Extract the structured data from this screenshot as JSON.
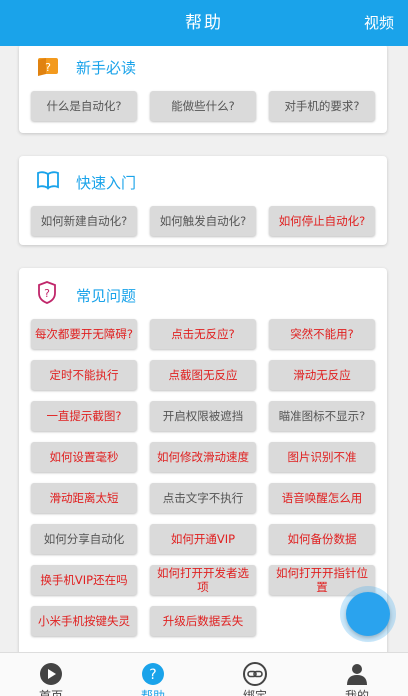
{
  "header": {
    "title": "帮助",
    "right_label": "视频"
  },
  "sections": [
    {
      "title": "新手必读",
      "icon": "book-icon",
      "buttons": [
        {
          "label": "什么是自动化?",
          "highlight": false
        },
        {
          "label": "能做些什么?",
          "highlight": false
        },
        {
          "label": "对手机的要求?",
          "highlight": false
        }
      ]
    },
    {
      "title": "快速入门",
      "icon": "open-book-icon",
      "buttons": [
        {
          "label": "如何新建自动化?",
          "highlight": false
        },
        {
          "label": "如何触发自动化?",
          "highlight": false
        },
        {
          "label": "如何停止自动化?",
          "highlight": true
        }
      ]
    },
    {
      "title": "常见问题",
      "icon": "question-shield-icon",
      "buttons": [
        {
          "label": "每次都要开无障碍?",
          "highlight": true
        },
        {
          "label": "点击无反应?",
          "highlight": true
        },
        {
          "label": "突然不能用?",
          "highlight": true
        },
        {
          "label": "定时不能执行",
          "highlight": true
        },
        {
          "label": "点截图无反应",
          "highlight": true
        },
        {
          "label": "滑动无反应",
          "highlight": true
        },
        {
          "label": "一直提示截图?",
          "highlight": true
        },
        {
          "label": "开启权限被遮挡",
          "highlight": false
        },
        {
          "label": "瞄准图标不显示?",
          "highlight": false
        },
        {
          "label": "如何设置毫秒",
          "highlight": true
        },
        {
          "label": "如何修改滑动速度",
          "highlight": true
        },
        {
          "label": "图片识别不准",
          "highlight": true
        },
        {
          "label": "滑动距离太短",
          "highlight": true
        },
        {
          "label": "点击文字不执行",
          "highlight": false
        },
        {
          "label": "语音唤醒怎么用",
          "highlight": true
        },
        {
          "label": "如何分享自动化",
          "highlight": false
        },
        {
          "label": "如何开通VIP",
          "highlight": true
        },
        {
          "label": "如何备份数据",
          "highlight": true
        },
        {
          "label": "换手机VIP还在吗",
          "highlight": true
        },
        {
          "label": "如何打开开发者选项",
          "highlight": true
        },
        {
          "label": "如何打开开指针位置",
          "highlight": true
        },
        {
          "label": "小米手机按键失灵",
          "highlight": true
        },
        {
          "label": "升级后数据丢失",
          "highlight": true
        }
      ]
    }
  ],
  "tabs": [
    {
      "label": "首页",
      "icon": "play-icon",
      "active": false
    },
    {
      "label": "帮助",
      "icon": "help-icon",
      "active": true
    },
    {
      "label": "绑定",
      "icon": "link-icon",
      "active": false
    },
    {
      "label": "我的",
      "icon": "user-icon",
      "active": false
    }
  ],
  "colors": {
    "accent": "#1aa3ea",
    "highlight_text": "#e02020",
    "button_bg": "#dadada"
  }
}
